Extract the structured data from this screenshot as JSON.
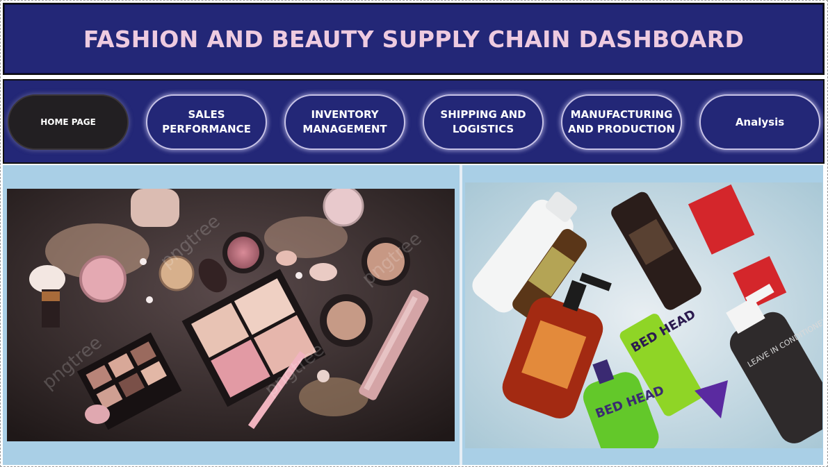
{
  "header": {
    "title": "FASHION AND BEAUTY SUPPLY CHAIN DASHBOARD"
  },
  "nav": {
    "items": [
      {
        "label": "HOME PAGE",
        "active": true
      },
      {
        "label": "SALES PERFORMANCE",
        "line1": "SALES",
        "line2": "PERFORMANCE"
      },
      {
        "label": "INVENTORY MANAGEMENT",
        "line1": "INVENTORY",
        "line2": "MANAGEMENT"
      },
      {
        "label": "SHIPPING AND LOGISTICS",
        "line1": "SHIPPING AND",
        "line2": "LOGISTICS"
      },
      {
        "label": "MANUFACTURING AND PRODUCTION",
        "line1": "MANUFACTURING",
        "line2": "AND PRODUCTION"
      },
      {
        "label": "Analysis"
      }
    ]
  },
  "images": {
    "left": {
      "watermark": "pngtree"
    },
    "right": {
      "bottle_text_1": "BED HEAD",
      "bottle_text_2": "BED HEAD",
      "bottle_text_3": "LEAVE IN CONDITIONER"
    }
  },
  "colors": {
    "banner": "#232777",
    "title": "#eecbe0",
    "content_bg": "#a9cfe6",
    "active_button": "#221f22"
  }
}
